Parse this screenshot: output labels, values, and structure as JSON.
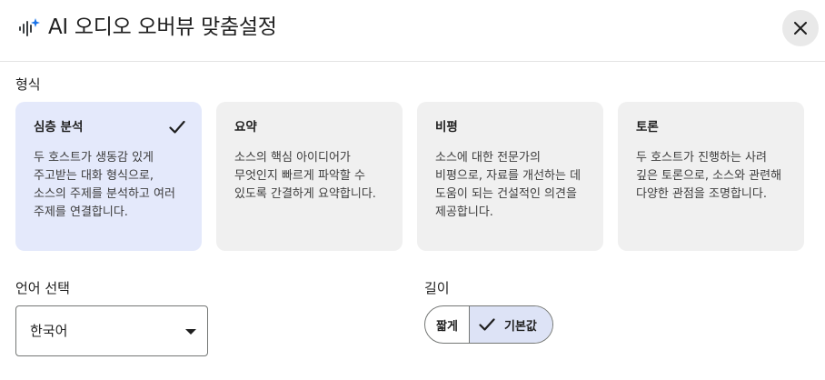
{
  "header": {
    "title": "AI 오디오 오버뷰 맞춤설정",
    "logo_icon": "sparkle-audio-icon",
    "close_icon": "close-icon"
  },
  "format": {
    "label": "형식",
    "cards": [
      {
        "title": "심층 분석",
        "description": "두 호스트가 생동감 있게 주고받는 대화 형식으로, 소스의 주제를 분석하고 여러 주제를 연결합니다.",
        "selected": true
      },
      {
        "title": "요약",
        "description": "소스의 핵심 아이디어가 무엇인지 빠르게 파악할 수 있도록 간결하게 요약합니다.",
        "selected": false
      },
      {
        "title": "비평",
        "description": "소스에 대한 전문가의 비평으로, 자료를 개선하는 데 도움이 되는 건설적인 의견을 제공합니다.",
        "selected": false
      },
      {
        "title": "토론",
        "description": "두 호스트가 진행하는 사려 깊은 토론으로, 소스와 관련해 다양한 관점을 조명합니다.",
        "selected": false
      }
    ]
  },
  "language": {
    "label": "언어 선택",
    "selected": "한국어"
  },
  "length": {
    "label": "길이",
    "options": [
      {
        "label": "짧게",
        "selected": false
      },
      {
        "label": "기본값",
        "selected": true
      }
    ]
  },
  "colors": {
    "selected_card_bg": "#e4e9fb",
    "card_bg": "#f0f0f0",
    "selected_segment_bg": "#dde3f6",
    "logo_blue": "#1a73e8"
  }
}
